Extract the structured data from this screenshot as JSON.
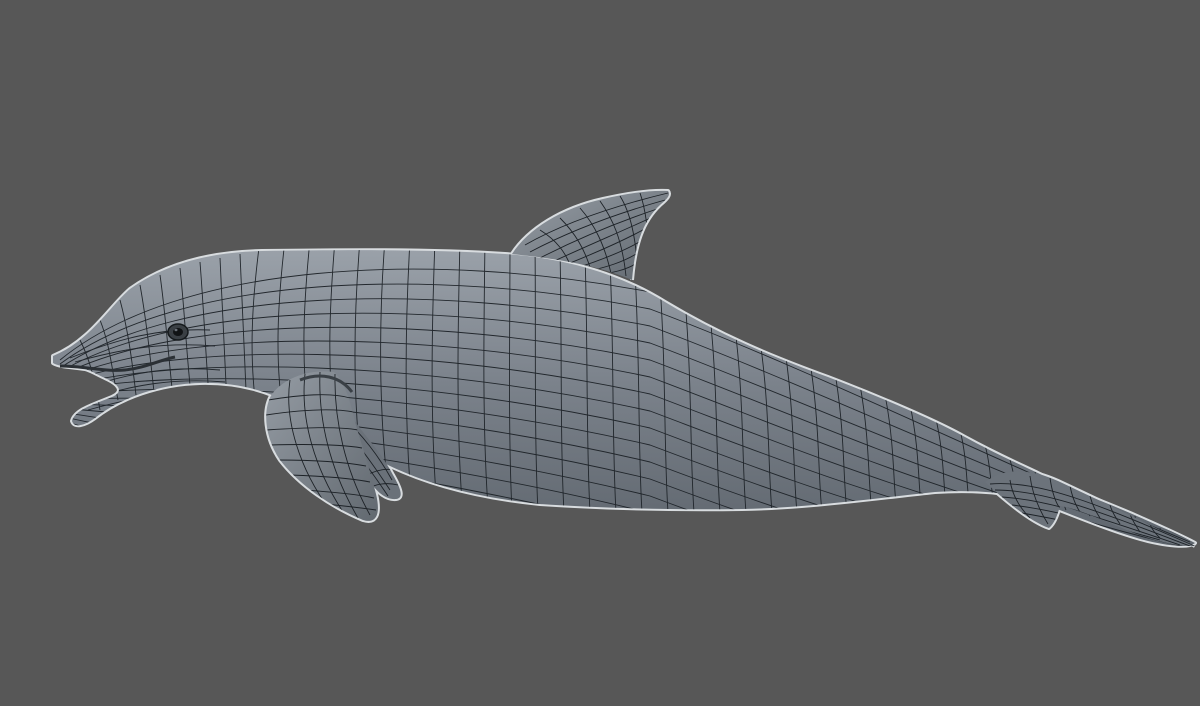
{
  "viewport": {
    "background_color": "#575757"
  },
  "model": {
    "subject": "dolphin",
    "display_mode": "wireframe-on-shaded",
    "surface_color": "#7d848d",
    "wire_color": "#1d2227",
    "outline_color": "#d8dcdf"
  }
}
